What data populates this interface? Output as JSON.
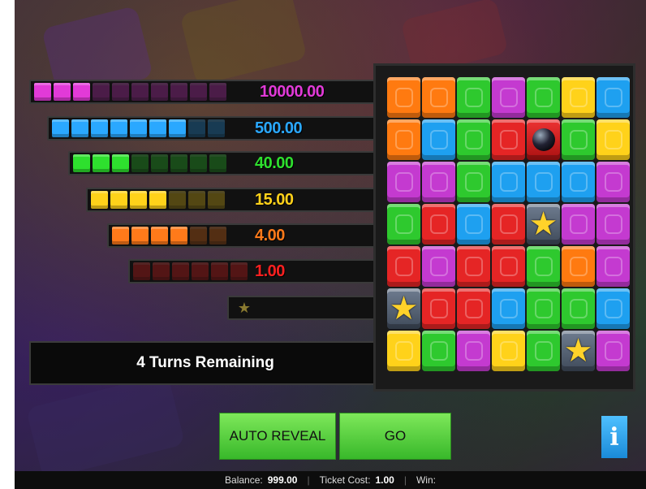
{
  "prize_table": [
    {
      "value": "10000.00",
      "color": "#e23ad8",
      "total": 10,
      "filled": 3
    },
    {
      "value": "500.00",
      "color": "#2aa8ff",
      "total": 9,
      "filled": 7
    },
    {
      "value": "40.00",
      "color": "#2ee02e",
      "total": 8,
      "filled": 3
    },
    {
      "value": "15.00",
      "color": "#ffd21a",
      "total": 7,
      "filled": 4
    },
    {
      "value": "4.00",
      "color": "#ff7a1a",
      "total": 6,
      "filled": 4
    },
    {
      "value": "1.00",
      "color": "#ff2020",
      "total": 6,
      "filled": 0
    },
    {
      "value": "",
      "color": "#c8a830",
      "total": 1,
      "filled": 0,
      "icon": "star-icon"
    }
  ],
  "turns_text": "4 Turns Remaining",
  "grid": [
    [
      "orange",
      "orange",
      "green",
      "purple",
      "green",
      "yellow",
      "blue"
    ],
    [
      "orange",
      "blue",
      "green",
      "red",
      "bomb",
      "green",
      "yellow"
    ],
    [
      "purple",
      "purple",
      "green",
      "blue",
      "blue",
      "blue",
      "purple"
    ],
    [
      "green",
      "red",
      "blue",
      "red",
      "star",
      "purple",
      "purple"
    ],
    [
      "red",
      "purple",
      "red",
      "red",
      "green",
      "orange",
      "purple"
    ],
    [
      "star",
      "red",
      "red",
      "blue",
      "green",
      "green",
      "blue"
    ],
    [
      "yellow",
      "green",
      "purple",
      "yellow",
      "green",
      "star",
      "purple"
    ]
  ],
  "tile_colors": {
    "orange": "#ff7a10",
    "green": "#2ec92e",
    "purple": "#c43ad0",
    "yellow": "#ffd21a",
    "blue": "#1ea0f0",
    "red": "#e52525"
  },
  "buttons": {
    "auto_reveal": "AUTO REVEAL",
    "go": "GO",
    "info": "i"
  },
  "footer": {
    "balance_label": "Balance:",
    "balance_value": "999.00",
    "ticket_label": "Ticket Cost:",
    "ticket_value": "1.00",
    "win_label": "Win:"
  }
}
